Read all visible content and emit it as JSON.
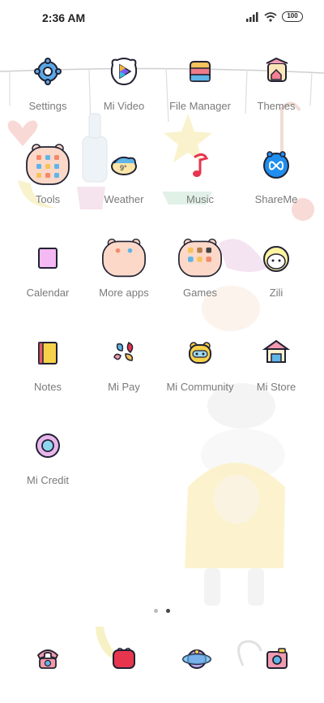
{
  "status_bar": {
    "time": "2:36 AM",
    "battery": "100",
    "icons": [
      "signal-icon",
      "wifi-icon",
      "battery-icon"
    ]
  },
  "apps": [
    {
      "label": "Settings",
      "icon": "settings-icon"
    },
    {
      "label": "Mi Video",
      "icon": "play-icon"
    },
    {
      "label": "File Manager",
      "icon": "folder-icon"
    },
    {
      "label": "Themes",
      "icon": "themes-icon"
    },
    {
      "label": "Tools",
      "icon": "tools-folder-icon"
    },
    {
      "label": "Weather",
      "icon": "weather-icon"
    },
    {
      "label": "Music",
      "icon": "music-note-icon"
    },
    {
      "label": "ShareMe",
      "icon": "shareme-icon"
    },
    {
      "label": "Calendar",
      "icon": "calendar-icon"
    },
    {
      "label": "More apps",
      "icon": "more-apps-folder-icon"
    },
    {
      "label": "Games",
      "icon": "games-folder-icon"
    },
    {
      "label": "Zili",
      "icon": "zili-icon"
    },
    {
      "label": "Notes",
      "icon": "notes-icon"
    },
    {
      "label": "Mi Pay",
      "icon": "mi-pay-icon"
    },
    {
      "label": "Mi Community",
      "icon": "mi-community-icon"
    },
    {
      "label": "Mi Store",
      "icon": "mi-store-icon"
    },
    {
      "label": "Mi Credit",
      "icon": "mi-credit-icon"
    }
  ],
  "page_indicator": {
    "pages": 2,
    "current": 2
  },
  "dock": [
    {
      "icon": "phone-icon"
    },
    {
      "icon": "messages-icon"
    },
    {
      "icon": "browser-icon"
    },
    {
      "icon": "camera-icon"
    }
  ]
}
